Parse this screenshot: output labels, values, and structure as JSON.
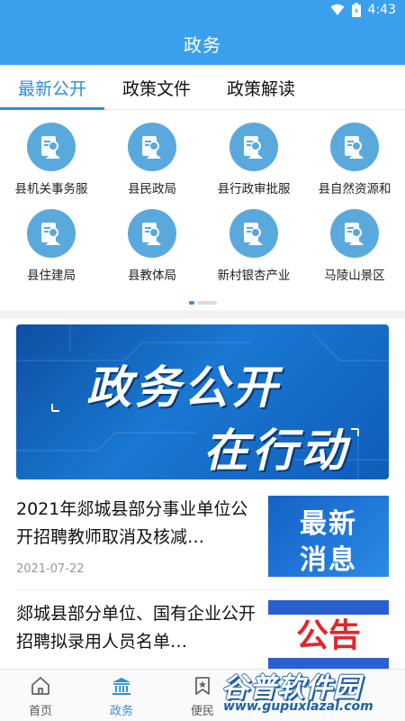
{
  "status_bar": {
    "time": "4:43"
  },
  "header": {
    "title": "政务"
  },
  "tabs": [
    {
      "label": "最新公开",
      "active": true
    },
    {
      "label": "政策文件",
      "active": false
    },
    {
      "label": "政策解读",
      "active": false
    }
  ],
  "departments": [
    {
      "label": "县机关事务服"
    },
    {
      "label": "县民政局"
    },
    {
      "label": "县行政审批服"
    },
    {
      "label": "县自然资源和"
    },
    {
      "label": "县住建局"
    },
    {
      "label": "县教体局"
    },
    {
      "label": "新村银杏产业"
    },
    {
      "label": "马陵山景区"
    }
  ],
  "banner": {
    "line1": "政务公开",
    "line2": "在行动"
  },
  "news": [
    {
      "title": "2021年郯城县部分事业单位公开招聘教师取消及核减…",
      "date": "2021-07-22",
      "thumb_line1": "最新",
      "thumb_line2": "消息"
    },
    {
      "title": "郯城县部分单位、国有企业公开招聘拟录用人员名单…",
      "date": "",
      "thumb_line1": "公告",
      "thumb_line2": ""
    }
  ],
  "bottom_nav": [
    {
      "label": "首页",
      "icon": "home-icon",
      "active": false
    },
    {
      "label": "政务",
      "icon": "government-building-icon",
      "active": true
    },
    {
      "label": "便民",
      "icon": "bookmark-star-icon",
      "active": false
    }
  ],
  "watermark": {
    "text": "谷普软件园",
    "url": "www.gupuxlazal.com"
  },
  "colors": {
    "primary": "#3aa0ee",
    "accent": "#2e8ee0",
    "icon_bg": "#5aa9dc"
  }
}
